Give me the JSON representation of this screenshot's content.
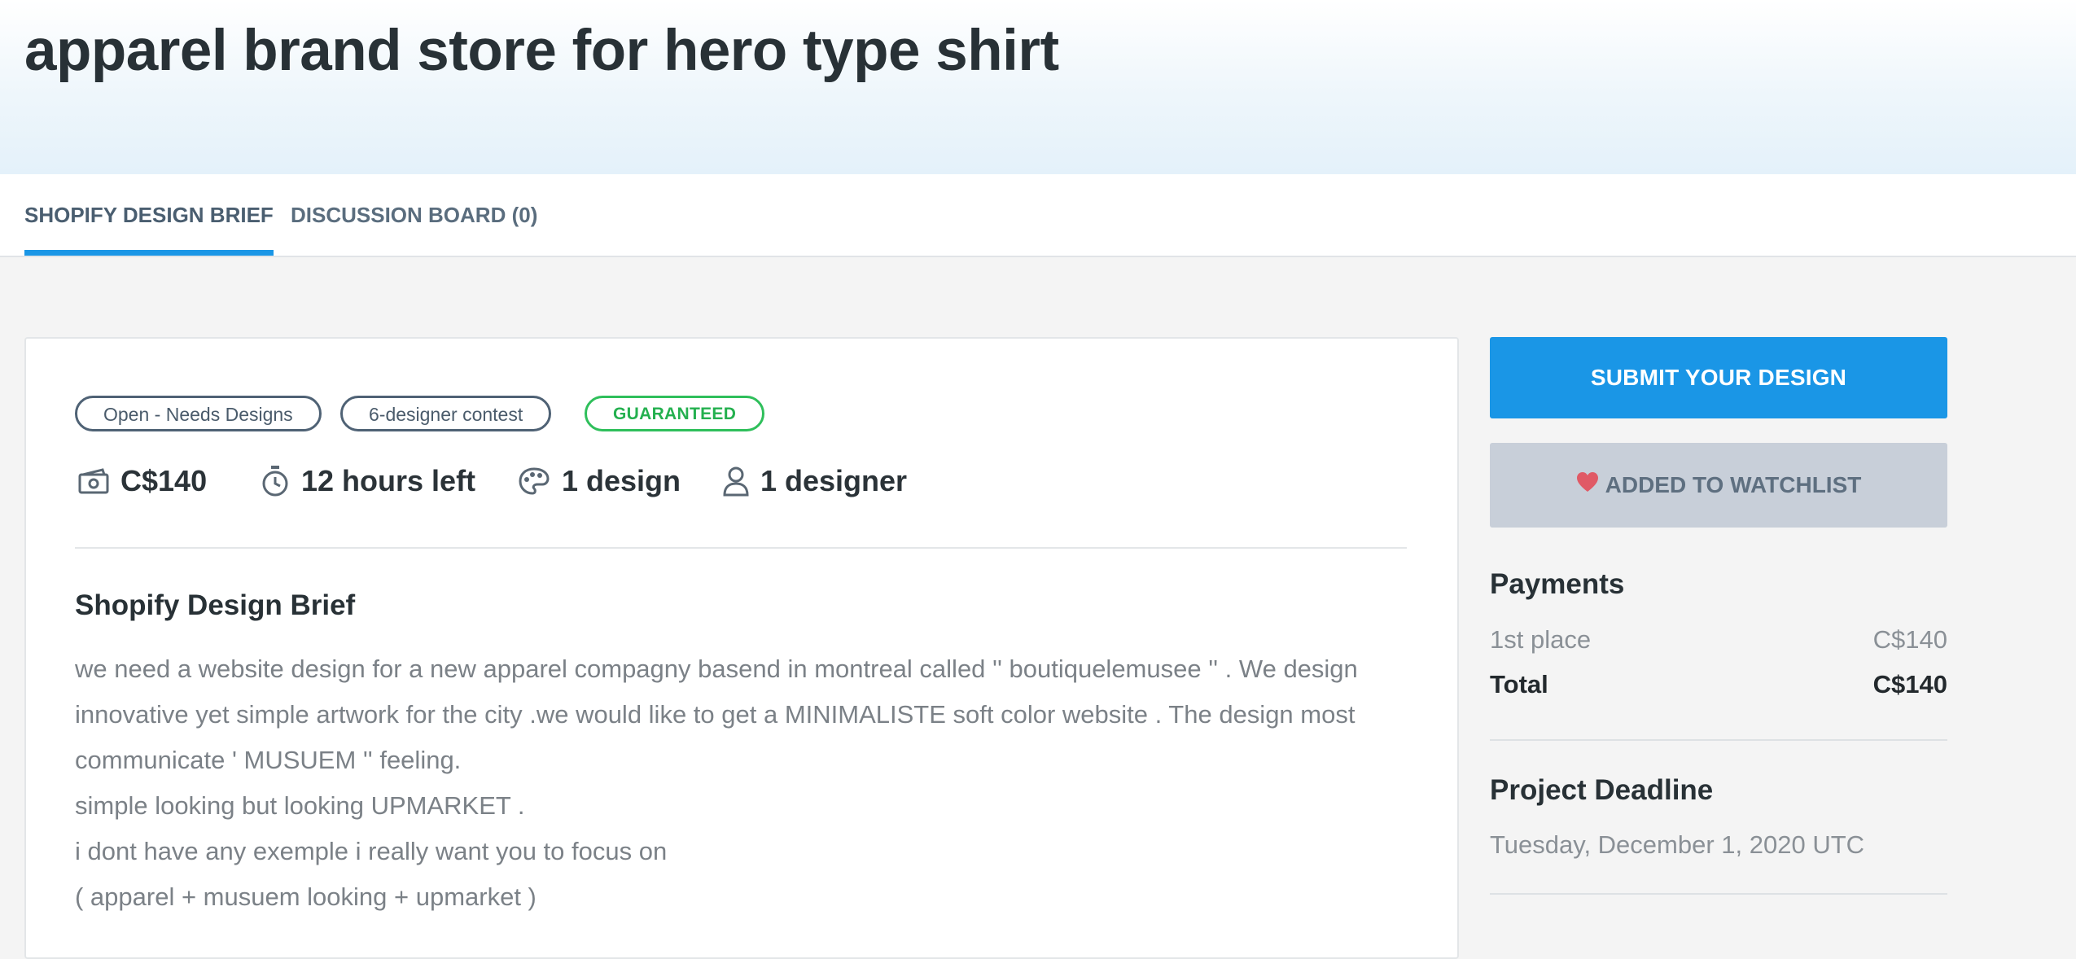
{
  "page": {
    "title": "apparel brand store for hero type shirt"
  },
  "tabs": [
    {
      "label": "SHOPIFY DESIGN BRIEF",
      "active": true
    },
    {
      "label": "DISCUSSION BOARD (0)",
      "active": false
    }
  ],
  "badges": {
    "status": "Open - Needs Designs",
    "contest_size": "6-designer contest",
    "guarantee": "GUARANTEED"
  },
  "stats": {
    "prize": "C$140",
    "time_left": "12 hours left",
    "designs": "1 design",
    "designers": "1 designer"
  },
  "brief": {
    "title": "Shopify Design Brief",
    "lines": [
      "we need a website design for a new apparel compagny basend in montreal called '' boutiquelemusee '' . We design",
      "innovative yet simple artwork for the city .we would like to get a MINIMALISTE soft color website . The design most",
      "communicate ' MUSUEM '' feeling.",
      "simple looking but looking UPMARKET .",
      "i dont have any exemple i really want you to focus on",
      "( apparel + musuem looking + upmarket )"
    ]
  },
  "sidebar": {
    "submit_label": "SUBMIT YOUR DESIGN",
    "watchlist_label": "ADDED TO WATCHLIST",
    "payments_title": "Payments",
    "payments": [
      {
        "label": "1st place",
        "amount": "C$140"
      },
      {
        "label": "Total",
        "amount": "C$140"
      }
    ],
    "deadline_title": "Project Deadline",
    "deadline_value": "Tuesday, December 1, 2020 UTC"
  },
  "colors": {
    "accent": "#1a96e6",
    "guaranteed": "#2fbf5b",
    "heart": "#e05a66"
  }
}
